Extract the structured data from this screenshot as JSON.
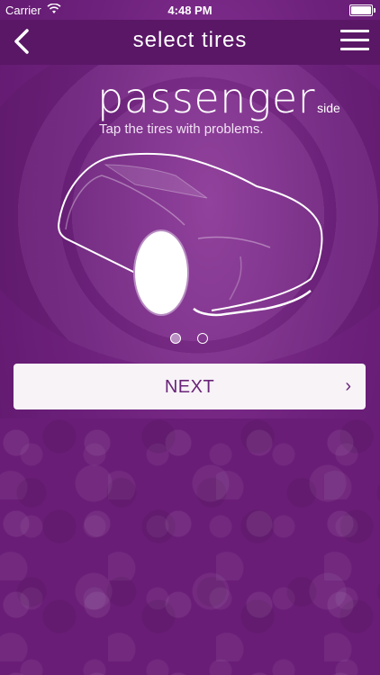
{
  "status_bar": {
    "carrier": "Carrier",
    "time": "4:48 PM",
    "wifi_icon": "wifi-icon",
    "battery_icon": "battery-icon"
  },
  "nav": {
    "title": "select tires",
    "back_icon": "chevron-left-icon",
    "menu_icon": "hamburger-menu-icon"
  },
  "content": {
    "side_word": "passenger",
    "side_suffix": "side",
    "instruction": "Tap the tires with problems."
  },
  "pager": {
    "page_count": 2,
    "current_page": 1
  },
  "next_button": {
    "label": "NEXT",
    "chevron": "›"
  },
  "colors": {
    "primary": "#6b1f78",
    "navbar": "#5a1766",
    "button_bg": "#f7f3f7",
    "button_text": "#6a2478",
    "dot_active": "#b98ec3"
  }
}
